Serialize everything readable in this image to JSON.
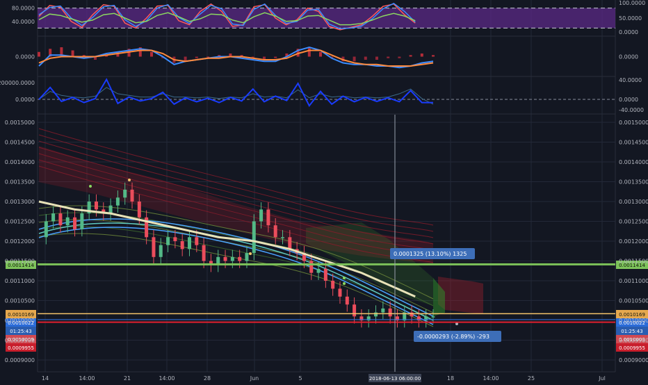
{
  "colors": {
    "background": "#131722",
    "grid": "#232838",
    "axis_text": "#b2b5be",
    "price_line": "#e8e2b8",
    "ma_blue": "#4aa3ff",
    "ma_teal": "#5ec9c2",
    "green_band": "#3f8c2a",
    "red_band": "#b3202e",
    "rsi_fill": "#5b2a86",
    "stoch_red": "#ff5a5a",
    "stoch_blue": "#3c8cff",
    "stoch_green": "#8bd860",
    "macd_orange": "#ff8a3c",
    "macd_blue": "#3c8cff",
    "vol_blue": "#1a3cff",
    "green_hline": "#7dc35a",
    "red_hline": "#e0202e",
    "orange_hline": "#f5c46a",
    "blue_hline": "#2a6bd8",
    "tooltip_bg": "#3d6eb8"
  },
  "chart_data": [
    {
      "type": "line",
      "panel": "oscillator",
      "left_ticks": [
        "80.0000",
        "40.0000"
      ],
      "right_ticks": [
        "100.0000",
        "50.0000",
        "0.0000"
      ],
      "ylim": [
        0,
        100
      ],
      "band": [
        20,
        80
      ],
      "series": [
        {
          "x": [
            0,
            3,
            6,
            9,
            12,
            15,
            18,
            21,
            24,
            27,
            30,
            33,
            36,
            39,
            42,
            45,
            48,
            51,
            54,
            57,
            60,
            63,
            66,
            69,
            72,
            75,
            78,
            81,
            84,
            87,
            90,
            93,
            96,
            99,
            102,
            105
          ],
          "values": [
            55,
            88,
            82,
            40,
            22,
            60,
            90,
            85,
            35,
            20,
            50,
            86,
            88,
            42,
            30,
            70,
            92,
            70,
            25,
            30,
            84,
            90,
            50,
            30,
            45,
            80,
            70,
            25,
            15,
            22,
            30,
            55,
            85,
            92,
            60,
            35
          ]
        },
        {
          "x": [
            0,
            3,
            6,
            9,
            12,
            15,
            18,
            21,
            24,
            27,
            30,
            33,
            36,
            39,
            42,
            45,
            48,
            51,
            54,
            57,
            60,
            63,
            66,
            69,
            72,
            75,
            78,
            81,
            84,
            87,
            90,
            93,
            96,
            99,
            102,
            105
          ],
          "values": [
            60,
            82,
            86,
            50,
            28,
            52,
            84,
            88,
            45,
            25,
            42,
            80,
            90,
            52,
            34,
            62,
            88,
            78,
            32,
            28,
            76,
            92,
            58,
            34,
            40,
            74,
            76,
            32,
            18,
            20,
            26,
            48,
            78,
            94,
            70,
            38
          ]
        },
        {
          "x": [
            0,
            3,
            6,
            9,
            12,
            15,
            18,
            21,
            24,
            27,
            30,
            33,
            36,
            39,
            42,
            45,
            48,
            51,
            54,
            57,
            60,
            63,
            66,
            69,
            72,
            75,
            78,
            81,
            84,
            87,
            90,
            93,
            96,
            99,
            102,
            105
          ],
          "values": [
            45,
            62,
            58,
            48,
            38,
            44,
            60,
            64,
            50,
            36,
            40,
            58,
            66,
            54,
            40,
            48,
            62,
            60,
            44,
            36,
            54,
            66,
            56,
            40,
            42,
            56,
            58,
            44,
            30,
            30,
            34,
            44,
            56,
            64,
            56,
            42
          ]
        }
      ]
    },
    {
      "type": "line",
      "panel": "macd",
      "left_ticks": [
        "0.0000"
      ],
      "right_ticks": [
        "0.0000"
      ],
      "ylim": [
        -1,
        1
      ],
      "histogram": [
        0.3,
        0.5,
        0.6,
        0.4,
        0.1,
        -0.2,
        0.1,
        0.3,
        0.5,
        0.6,
        0.3,
        -0.1,
        -0.4,
        -0.3,
        -0.1,
        0.0,
        0.1,
        0.2,
        0.1,
        -0.1,
        -0.2,
        -0.1,
        0.2,
        0.5,
        0.6,
        0.3,
        -0.1,
        -0.3,
        -0.3,
        -0.2,
        -0.2,
        -0.1,
        -0.1,
        0.1,
        0.2,
        0.1
      ],
      "series": [
        {
          "values": [
            -0.6,
            0.1,
            0.1,
            0.0,
            -0.1,
            0.0,
            0.2,
            0.3,
            0.4,
            0.5,
            0.4,
            0.0,
            -0.5,
            -0.3,
            -0.2,
            -0.1,
            0.0,
            0.0,
            -0.1,
            -0.2,
            -0.3,
            -0.3,
            0.0,
            0.4,
            0.6,
            0.4,
            -0.1,
            -0.4,
            -0.5,
            -0.5,
            -0.6,
            -0.6,
            -0.7,
            -0.6,
            -0.4,
            -0.3
          ]
        },
        {
          "values": [
            -0.4,
            -0.1,
            0.0,
            0.0,
            0.0,
            0.0,
            0.1,
            0.2,
            0.3,
            0.4,
            0.4,
            0.2,
            -0.2,
            -0.3,
            -0.2,
            -0.1,
            -0.1,
            0.0,
            0.0,
            -0.1,
            -0.2,
            -0.2,
            -0.1,
            0.2,
            0.4,
            0.4,
            0.1,
            -0.2,
            -0.4,
            -0.5,
            -0.5,
            -0.6,
            -0.6,
            -0.6,
            -0.5,
            -0.4
          ]
        }
      ]
    },
    {
      "type": "line",
      "panel": "volume_oscillator",
      "left_ticks": [
        "200000.0000",
        "0.0000"
      ],
      "right_ticks": [
        "40.0000",
        "0.0000",
        "-40.0000"
      ],
      "ylim": [
        -40,
        40
      ],
      "series": [
        {
          "values": [
            0,
            30,
            -5,
            5,
            -8,
            2,
            50,
            -10,
            6,
            -4,
            2,
            18,
            -12,
            4,
            -6,
            3,
            -8,
            5,
            -4,
            26,
            -6,
            8,
            -3,
            40,
            -16,
            20,
            -12,
            8,
            -6,
            5,
            -5,
            4,
            -6,
            22,
            -8,
            -8
          ]
        },
        {
          "values": [
            0,
            20,
            10,
            6,
            4,
            8,
            30,
            14,
            10,
            6,
            6,
            14,
            6,
            6,
            4,
            6,
            2,
            6,
            4,
            14,
            6,
            8,
            4,
            24,
            4,
            14,
            6,
            8,
            4,
            6,
            4,
            6,
            14,
            26,
            2,
            -12
          ]
        }
      ]
    },
    {
      "type": "line",
      "panel": "price",
      "ylim": [
        0.00087,
        0.00153
      ],
      "y_ticks": [
        "0.0015000",
        "0.0014500",
        "0.0014000",
        "0.0013500",
        "0.0013000",
        "0.0012500",
        "0.0012000",
        "0.0011500",
        "0.0011000",
        "0.0010500",
        "0.0010000",
        "0.0009500",
        "0.0009000"
      ],
      "right_ticks": [
        "0.0015000",
        "0.0014500",
        "0.0014000",
        "0.0013500",
        "0.0013000",
        "0.0012500",
        "0.0012000",
        "0.0011500",
        "0.0011000",
        "0.0010500",
        "0.0010000",
        "0.0009500",
        "0.0009000"
      ],
      "x_labels": [
        "14",
        "14:00",
        "21",
        "14:00",
        "28",
        "Jun",
        "5",
        "18",
        "14:00",
        "25",
        "Jul"
      ],
      "crosshair_date": "2018-06-13 06:00:00",
      "price": {
        "x": [
          0,
          2,
          4,
          6,
          8,
          10,
          12,
          14,
          16,
          18,
          20,
          22,
          24,
          26,
          28,
          30,
          32,
          34,
          36,
          38,
          40,
          42,
          44,
          46,
          48,
          50,
          52,
          54,
          56,
          58,
          60,
          62,
          64,
          66,
          68,
          70,
          72,
          74,
          76,
          78,
          80,
          82,
          84,
          86,
          88,
          90,
          92,
          94,
          96,
          98,
          100,
          102,
          104,
          106,
          108,
          110
        ],
        "values": [
          0.00121,
          0.00125,
          0.00127,
          0.00124,
          0.00126,
          0.00123,
          0.00127,
          0.0013,
          0.00128,
          0.00127,
          0.00129,
          0.00131,
          0.00133,
          0.0013,
          0.00126,
          0.00121,
          0.00116,
          0.00119,
          0.00121,
          0.0012,
          0.00118,
          0.00121,
          0.00119,
          0.00115,
          0.00114,
          0.00116,
          0.00115,
          0.00116,
          0.00115,
          0.00117,
          0.00125,
          0.00128,
          0.00124,
          0.00121,
          0.00121,
          0.00118,
          0.00117,
          0.00115,
          0.00112,
          0.00113,
          0.0011,
          0.00108,
          0.00106,
          0.00104,
          0.00101,
          0.001,
          0.00101,
          0.00102,
          0.00103,
          0.00101,
          0.001,
          0.00102,
          0.00101,
          0.001,
          0.00101,
          0.00101
        ]
      },
      "ma_slow": {
        "x": [
          0,
          10,
          20,
          30,
          40,
          50,
          60,
          70,
          80,
          90,
          100,
          105
        ],
        "values": [
          0.0013,
          0.00128,
          0.00127,
          0.00125,
          0.00123,
          0.00121,
          0.0012,
          0.00118,
          0.00115,
          0.00112,
          0.00108,
          0.00106
        ]
      },
      "horizontal_lines": [
        {
          "label": "0.0011414",
          "value": 0.0011414
        },
        {
          "label": "0.0010169",
          "value": 0.0010169
        },
        {
          "label": "0.0010022",
          "value": 0.0010022
        },
        {
          "label": "0.0010009",
          "value": 0.0010009
        },
        {
          "label": "0.0009955",
          "value": 0.0009955
        }
      ],
      "countdown_left": "01:25:43",
      "countdown_right": "01:25:43",
      "measure_up": "0.0001325 (13.10%) 1325",
      "measure_down": "-0.0000293 (-2.89%) -293"
    }
  ]
}
